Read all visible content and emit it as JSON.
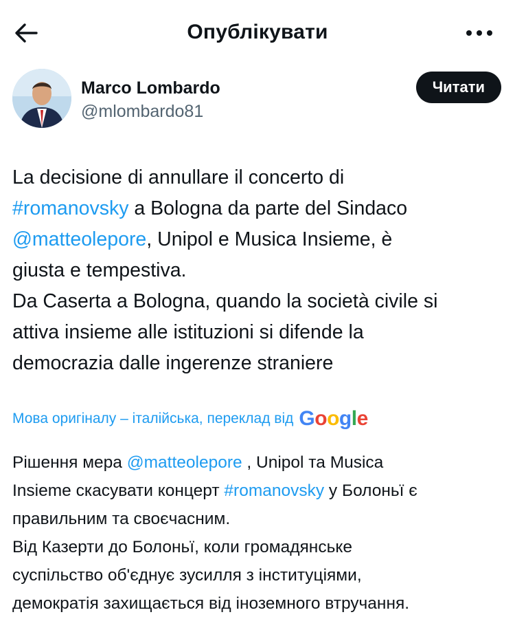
{
  "header": {
    "back_icon": "arrow-left-icon",
    "title": "Опублікувати",
    "more_icon": "more-horizontal-icon"
  },
  "author": {
    "name": "Marco Lombardo",
    "handle": "@mlombardo81",
    "follow_label": "Читати"
  },
  "post": {
    "segments": [
      {
        "text": "La decisione di annullare il concerto di\n",
        "type": "text"
      },
      {
        "text": "#romanovsky",
        "type": "link"
      },
      {
        "text": " a Bologna da parte del Sindaco\n",
        "type": "text"
      },
      {
        "text": "@matteolepore",
        "type": "link"
      },
      {
        "text": ", Unipol e Musica Insieme, è\ngiusta e tempestiva.\nDa Caserta a Bologna, quando la società civile si\nattiva insieme alle istituzioni si difende la\ndemocrazia dalle ingerenze straniere",
        "type": "text"
      }
    ]
  },
  "translation": {
    "note": "Мова оригіналу – італійська, переклад від",
    "provider": "Google",
    "segments": [
      {
        "text": "Рішення мера ",
        "type": "text"
      },
      {
        "text": "@matteolepore",
        "type": "link"
      },
      {
        "text": " , Unipol та Musica\nInsieme скасувати концерт ",
        "type": "text"
      },
      {
        "text": "#romanovsky",
        "type": "link"
      },
      {
        "text": " у Болоньї є\nправильним та своєчасним.\nВід Казерти до Болоньї, коли громадянське\nсуспільство об'єднує зусилля з інституціями,\nдемократія захищається від іноземного втручання.",
        "type": "text"
      }
    ]
  },
  "colors": {
    "link": "#1d9bf0",
    "text": "#0f1419",
    "secondary": "#536471",
    "button_bg": "#0f1419"
  }
}
